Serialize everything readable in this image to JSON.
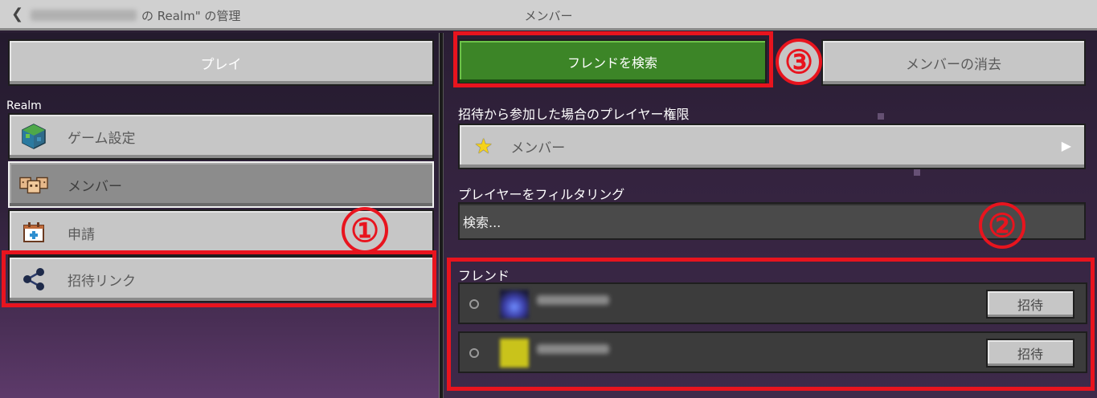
{
  "titlebar": {
    "title_suffix": "の Realm\" の管理",
    "center_title": "メンバー"
  },
  "left": {
    "play_label": "プレイ",
    "section_label": "Realm",
    "items": [
      {
        "label": "ゲーム設定",
        "icon": "globe-icon"
      },
      {
        "label": "メンバー",
        "icon": "members-icon"
      },
      {
        "label": "申請",
        "icon": "request-icon"
      },
      {
        "label": "招待リンク",
        "icon": "share-link-icon"
      }
    ]
  },
  "right": {
    "find_friends_label": "フレンドを検索",
    "clear_members_label": "メンバーの消去",
    "permission_label": "招待から参加した場合のプレイヤー権限",
    "permission_value": "メンバー",
    "filter_label": "プレイヤーをフィルタリング",
    "search_placeholder": "検索...",
    "friends_label": "フレンド",
    "friends": [
      {
        "invite_label": "招待"
      },
      {
        "invite_label": "招待"
      }
    ]
  },
  "annotations": {
    "n1": "①",
    "n2": "②",
    "n3": "③"
  },
  "colors": {
    "highlight": "#e8141e",
    "find_button": "#3c8527"
  }
}
